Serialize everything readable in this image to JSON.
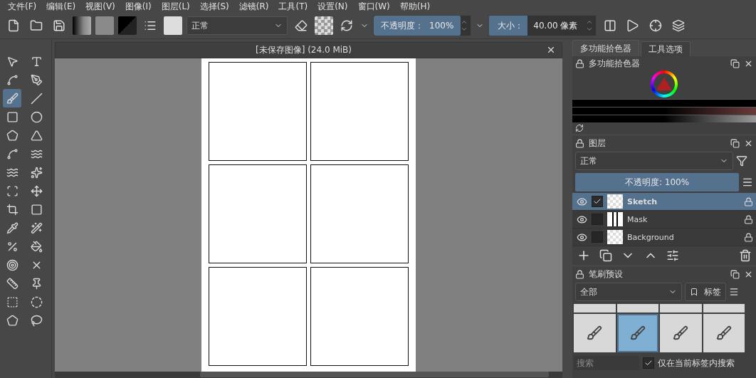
{
  "menu": [
    "文件(F)",
    "编辑(E)",
    "视图(V)",
    "图像(I)",
    "图层(L)",
    "选择(S)",
    "滤镜(R)",
    "工具(T)",
    "设置(N)",
    "窗口(W)",
    "帮助(H)"
  ],
  "toolbar": {
    "blend_mode": "正常",
    "opacity": {
      "label": "不透明度：",
      "value": "100%",
      "level": 1
    },
    "size_label": "大小：",
    "size_value": "40.00 像素"
  },
  "tools": [
    {
      "kind": "select",
      "selected": false
    },
    {
      "kind": "text",
      "selected": false
    },
    {
      "kind": "edit-shape",
      "selected": false
    },
    {
      "kind": "calligraphy",
      "selected": false
    },
    {
      "kind": "brush",
      "selected": true
    },
    {
      "kind": "line",
      "selected": false
    },
    {
      "kind": "rectangle",
      "selected": false
    },
    {
      "kind": "ellipse",
      "selected": false
    },
    {
      "kind": "polygon",
      "selected": false
    },
    {
      "kind": "polyline",
      "selected": false
    },
    {
      "kind": "bezier",
      "selected": false
    },
    {
      "kind": "path",
      "selected": false
    },
    {
      "kind": "freehand",
      "selected": false
    },
    {
      "kind": "multibrush",
      "selected": false
    },
    {
      "kind": "transform",
      "selected": false
    },
    {
      "kind": "move",
      "selected": false
    },
    {
      "kind": "crop",
      "selected": false
    },
    {
      "kind": "gradient",
      "selected": false
    },
    {
      "kind": "picker",
      "selected": false
    },
    {
      "kind": "colorize",
      "selected": false
    },
    {
      "kind": "patch",
      "selected": false
    },
    {
      "kind": "fill",
      "selected": false
    },
    {
      "kind": "enclose",
      "selected": false
    },
    {
      "kind": "assistant",
      "selected": false
    },
    {
      "kind": "measure",
      "selected": false
    },
    {
      "kind": "pin",
      "selected": false
    },
    {
      "kind": "rect-select",
      "selected": false
    },
    {
      "kind": "ellipse-select",
      "selected": false
    },
    {
      "kind": "poly-select",
      "selected": false
    },
    {
      "kind": "free-select",
      "selected": false
    }
  ],
  "document": {
    "title": "[未保存图像] (24.0 MiB)"
  },
  "docker_tabs": [
    {
      "label": "多功能拾色器",
      "selected": true
    },
    {
      "label": "工具选项",
      "selected": false
    }
  ],
  "color_picker": {
    "title": "多功能拾色器"
  },
  "layers": {
    "title": "图层",
    "blend_mode": "正常",
    "opacity": {
      "value": "不透明度: 100%",
      "level": 1
    },
    "items": [
      {
        "name": "Sketch",
        "kind": "paint",
        "visible": true,
        "checked": true,
        "selected": true
      },
      {
        "name": "Mask",
        "kind": "mask",
        "visible": true,
        "checked": false,
        "selected": false
      },
      {
        "name": "Background",
        "kind": "paint",
        "visible": true,
        "checked": false,
        "selected": false
      }
    ]
  },
  "brush_presets": {
    "title": "笔刷预设",
    "filter": "全部",
    "tag": "标签",
    "search_placeholder": "搜索",
    "search_in_tag": {
      "label": "仅在当前标签内搜索",
      "checked": true
    },
    "presets": [
      {
        "selected": false
      },
      {
        "selected": false
      },
      {
        "selected": false
      },
      {
        "selected": false
      },
      {
        "selected": false
      },
      {
        "selected": true
      },
      {
        "selected": false
      },
      {
        "selected": false
      }
    ]
  }
}
